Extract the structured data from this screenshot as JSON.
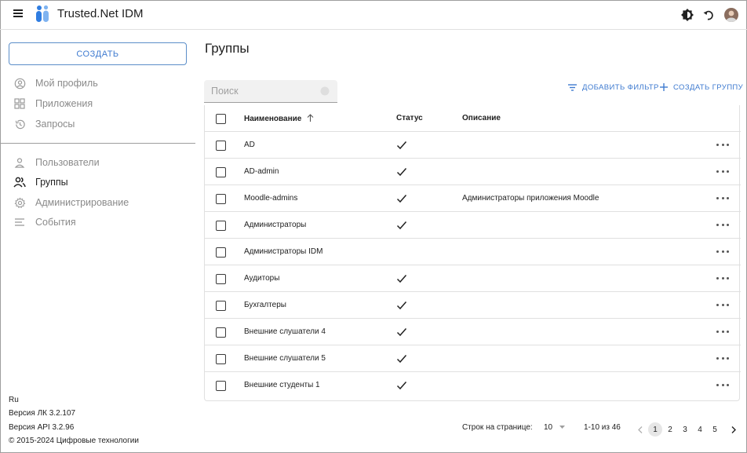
{
  "header": {
    "app_title": "Trusted.Net IDM",
    "icons": [
      "menu-icon",
      "theme-toggle-icon",
      "refresh-icon",
      "avatar"
    ]
  },
  "sidebar": {
    "create_label": "СОЗДАТЬ",
    "top_items": [
      {
        "label": "Мой профиль",
        "icon": "profile-icon"
      },
      {
        "label": "Приложения",
        "icon": "apps-icon"
      },
      {
        "label": "Запросы",
        "icon": "history-icon"
      }
    ],
    "admin_items": [
      {
        "label": "Пользователи",
        "icon": "user-icon"
      },
      {
        "label": "Группы",
        "icon": "groups-icon",
        "active": true
      },
      {
        "label": "Администрирование",
        "icon": "gear-icon"
      },
      {
        "label": "События",
        "icon": "events-icon"
      }
    ],
    "footer": {
      "language": "Ru",
      "version_lk": "Версия ЛК 3.2.107",
      "version_api": "Версия API 3.2.96",
      "copyright": "© 2015-2024 Цифровые технологии"
    }
  },
  "main": {
    "title": "Группы",
    "search_placeholder": "Поиск",
    "add_filter_label": "ДОБАВИТЬ ФИЛЬТР",
    "create_group_label": "СОЗДАТЬ ГРУППУ",
    "columns": {
      "name": "Наименование",
      "status": "Статус",
      "description": "Описание"
    },
    "rows": [
      {
        "name": "AD",
        "status": true,
        "description": ""
      },
      {
        "name": "AD-admin",
        "status": true,
        "description": ""
      },
      {
        "name": "Moodle-admins",
        "status": true,
        "description": "Администраторы приложения Moodle"
      },
      {
        "name": "Администраторы",
        "status": true,
        "description": ""
      },
      {
        "name": "Администраторы IDM",
        "status": false,
        "description": ""
      },
      {
        "name": "Аудиторы",
        "status": true,
        "description": ""
      },
      {
        "name": "Бухгалтеры",
        "status": true,
        "description": ""
      },
      {
        "name": "Внешние слушатели 4",
        "status": true,
        "description": ""
      },
      {
        "name": "Внешние слушатели 5",
        "status": true,
        "description": ""
      },
      {
        "name": "Внешние студенты 1",
        "status": true,
        "description": ""
      }
    ]
  },
  "pagination": {
    "rows_per_page_label": "Строк на странице:",
    "rows_per_page_value": "10",
    "range_text": "1-10 из 46",
    "pages": [
      "1",
      "2",
      "3",
      "4",
      "5"
    ],
    "current_page": "1"
  }
}
